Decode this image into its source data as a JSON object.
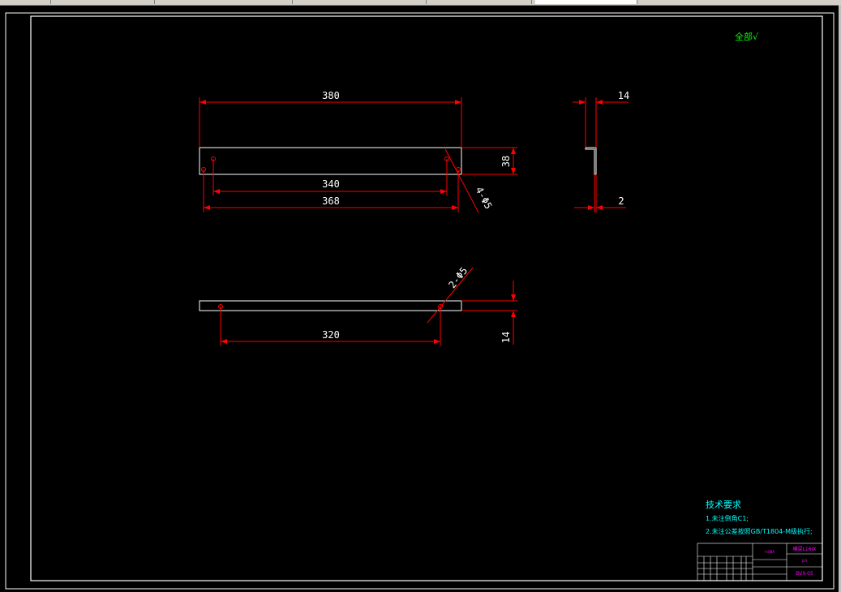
{
  "title_block": {
    "top_left": "I-UIBA",
    "header_right": "横梁L16IX",
    "subtitle": "JLR",
    "drawing_no": "BVX-05"
  },
  "notes": {
    "title": "技术要求",
    "items": [
      "1.未注倒角C1;",
      "2.未注公差按照GB/T1804-M级执行;"
    ]
  },
  "roughness": {
    "label": "全部",
    "symbol": "√"
  },
  "dimensions": {
    "top_length": "380",
    "hole_span_inner": "340",
    "hole_span_outer": "368",
    "height": "38",
    "top_holes": "4-Φ5",
    "side_flange": "14",
    "side_thickness": "2",
    "bottom_hole_span": "320",
    "bottom_holes": "2-Φ5",
    "bottom_thickness": "14"
  },
  "colors": {
    "background": "#000000",
    "outline": "#ffffff",
    "dimension": "#ff0000",
    "notes": "#00ffff",
    "title_block": "#ff00ff",
    "roughness": "#00ff00"
  }
}
